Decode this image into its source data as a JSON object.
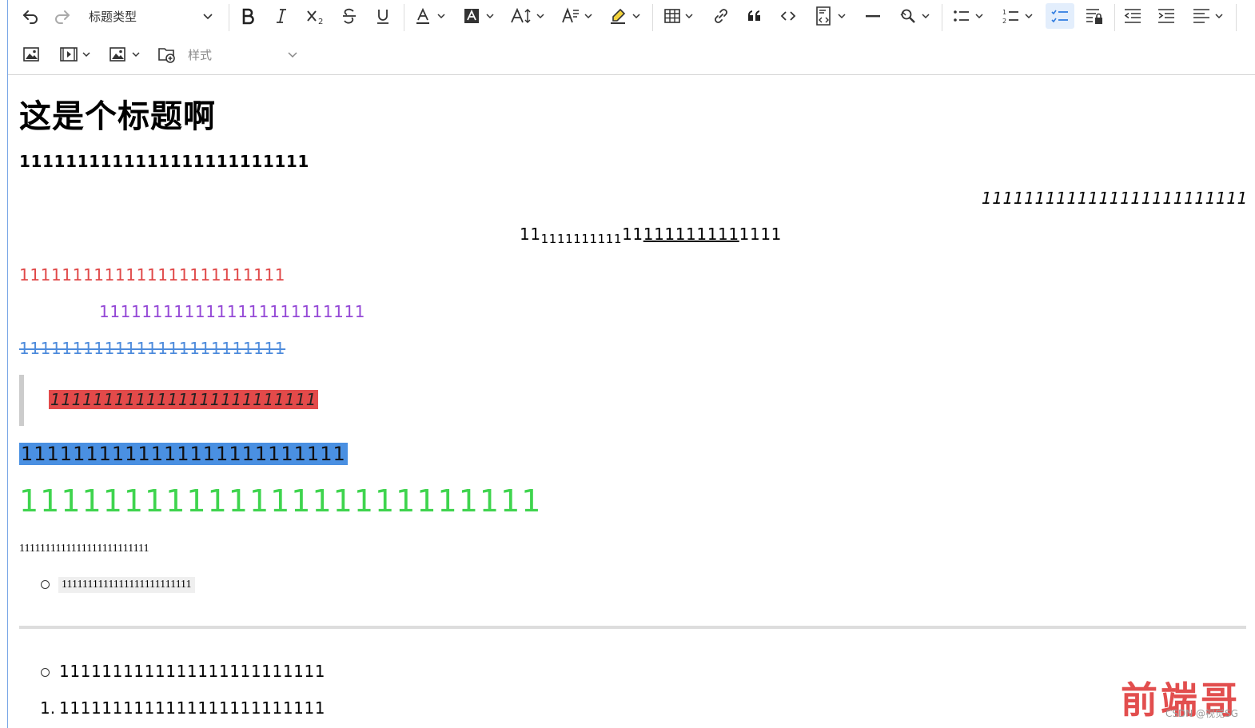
{
  "toolbar": {
    "heading_select": "标题类型",
    "style_select_placeholder": "样式"
  },
  "content": {
    "heading": "这是个标题啊",
    "bold_line": "1111111111111111111111111",
    "right_italic_line": "1111111111111111111111111",
    "center_line": {
      "a": "11",
      "sub": "1111111111",
      "b": "11",
      "underlined": "111111111",
      "c": "1111"
    },
    "red_line": "1111111111111111111111111",
    "purple_line": "1111111111111111111111111",
    "strike_line": "1111111111111111111111111",
    "quote_line": "1111111111111111111111111",
    "bluebg_line": "1111111111111111111111111",
    "green_line": "1111111111111111111111111",
    "serif_line": "1111111111111111111111111",
    "code_item": "1111111111111111111111111",
    "bullet_item": "1111111111111111111111111",
    "ordered_item_number": "1.",
    "ordered_item": "1111111111111111111111111"
  },
  "colors": {
    "red": "#e04848",
    "purple": "#9448d6",
    "blue": "#4d8bdc",
    "green": "#3fd44e",
    "active_button_bg": "#e3eefc"
  },
  "watermark": {
    "main": "前端哥",
    "sub": "CSDN @视觉SG"
  }
}
